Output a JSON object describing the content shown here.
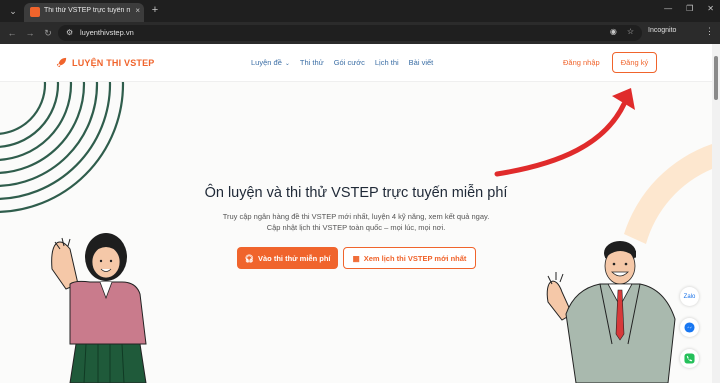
{
  "browser": {
    "tab_title": "Thi thử VSTEP trực tuyến miễn ph",
    "tab_close": "×",
    "new_tab": "+",
    "url": "luyenthivstep.vn",
    "incognito_label": "Incognito"
  },
  "header": {
    "logo_text": "LUYỆN THI VSTEP",
    "nav": [
      {
        "label": "Luyện đề",
        "has_dropdown": true
      },
      {
        "label": "Thi thử"
      },
      {
        "label": "Gói cước"
      },
      {
        "label": "Lịch thi"
      },
      {
        "label": "Bài viết"
      }
    ],
    "login_label": "Đăng nhập",
    "register_label": "Đăng ký"
  },
  "hero": {
    "title": "Ôn luyện và thi thử VSTEP trực tuyến miễn phí",
    "subtitle_line1": "Truy cập ngân hàng đề thi VSTEP mới nhất, luyện 4 kỹ năng, xem kết quả ngay.",
    "subtitle_line2": "Cập nhật lịch thi VSTEP toàn quốc – mọi lúc, mọi nơi.",
    "primary_button": "Vào thi thử miễn phí",
    "secondary_button": "Xem lịch thi VSTEP mới nhất"
  },
  "floating": {
    "zalo_label": "Zalo"
  },
  "colors": {
    "brand": "#f0642c",
    "nav_link": "#3b6ea5",
    "arrow": "#e02b2b",
    "deco_rings": "#2f5d4c",
    "deco_peach": "#fde7cf"
  }
}
